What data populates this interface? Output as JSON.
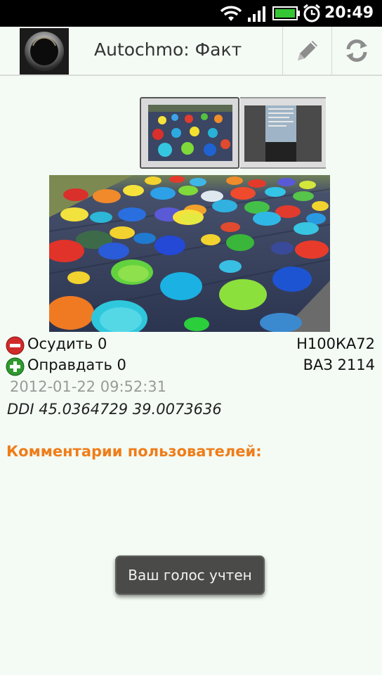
{
  "status_bar": {
    "time": "20:49",
    "icons": [
      "wifi-icon",
      "signal-icon",
      "battery-icon",
      "alarm-icon"
    ]
  },
  "action_bar": {
    "title": "Autochmo: Факт",
    "app_icon": "app-logo-icon",
    "actions": [
      "edit-icon",
      "refresh-icon"
    ]
  },
  "fact": {
    "condemn_label": "Осудить 0",
    "acquit_label": "Оправдать 0",
    "plate": "Н100КА72",
    "car_model": "ВАЗ 2114",
    "datetime": "2012-01-22 09:52:31",
    "coordinates": "DDI 45.0364729 39.0073636"
  },
  "comments": {
    "heading": "Комментарии пользователей:"
  },
  "toast": {
    "text": "Ваш голос учтен"
  },
  "colors": {
    "accent_orange": "#ef7d1a",
    "condemn_red": "#d02a2a",
    "acquit_green": "#2e9a2e",
    "background": "#f4fbf4"
  }
}
